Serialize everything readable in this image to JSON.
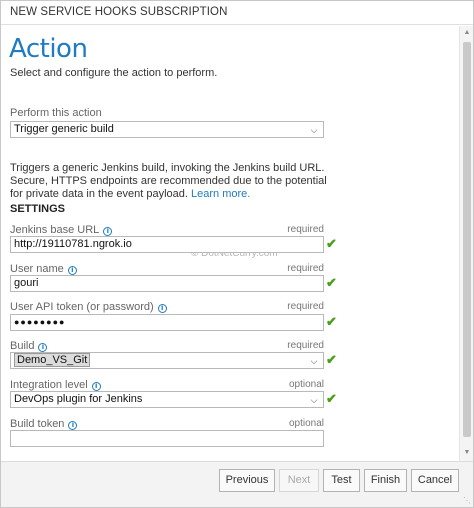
{
  "window": {
    "title": "NEW SERVICE HOOKS SUBSCRIPTION"
  },
  "header": {
    "title": "Action",
    "subtitle": "Select and configure the action to perform."
  },
  "action": {
    "label": "Perform this action",
    "selected": "Trigger generic build",
    "description": "Triggers a generic Jenkins build, invoking the Jenkins build URL. Secure, HTTPS endpoints are recommended due to the potential for private data in the event payload.",
    "learn_more": "Learn more."
  },
  "settings": {
    "heading": "SETTINGS",
    "jenkins_url": {
      "label": "Jenkins base URL",
      "status": "required",
      "value": "http://19110781.ngrok.io"
    },
    "username": {
      "label": "User name",
      "status": "required",
      "value": "gouri"
    },
    "api_token": {
      "label": "User API token (or password)",
      "status": "required",
      "value": "●●●●●●●●"
    },
    "build": {
      "label": "Build",
      "status": "required",
      "value": "Demo_VS_Git"
    },
    "integration": {
      "label": "Integration level",
      "status": "optional",
      "value": "DevOps plugin for Jenkins"
    },
    "build_token": {
      "label": "Build token",
      "status": "optional",
      "value": ""
    }
  },
  "watermark": "© DotNetCurry.com",
  "footer": {
    "previous": "Previous",
    "next": "Next",
    "test": "Test",
    "finish": "Finish",
    "cancel": "Cancel"
  },
  "icons": {
    "info": "info-icon",
    "check": "checkmark-icon",
    "dropdown": "chevron-down-icon"
  },
  "colors": {
    "accent": "#1e7bc4",
    "valid": "#4a9e1c"
  }
}
